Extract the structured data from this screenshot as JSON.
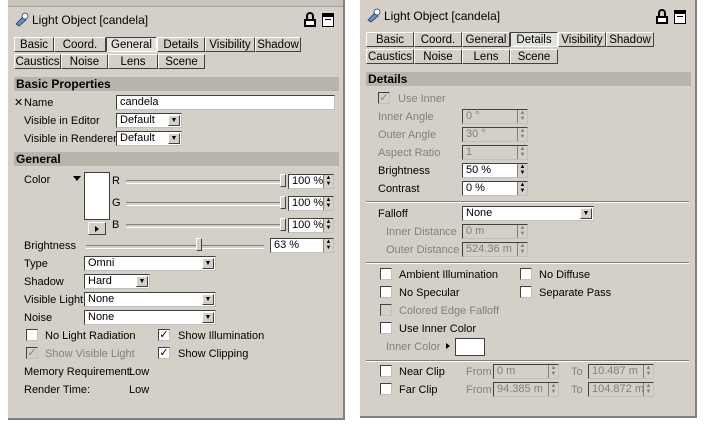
{
  "left": {
    "title": "Light Object [candela]",
    "tabs_row1": [
      "Basic",
      "Coord.",
      "General",
      "Details",
      "Visibility",
      "Shadow"
    ],
    "tabs_row2": [
      "Caustics",
      "Noise",
      "Lens",
      "Scene"
    ],
    "active_tab": "General",
    "basic_section": "Basic Properties",
    "name_label": "Name",
    "name_value": "candela",
    "vis_editor_label": "Visible in Editor",
    "vis_editor_value": "Default",
    "vis_renderer_label": "Visible in Renderer",
    "vis_renderer_value": "Default",
    "general_section": "General",
    "color_label": "Color",
    "r_label": "R",
    "r_value": "100 %",
    "g_label": "G",
    "g_value": "100 %",
    "b_label": "B",
    "b_value": "100 %",
    "rgb_levels_percent": [
      100,
      100,
      100
    ],
    "brightness_label": "Brightness",
    "brightness_value": "63 %",
    "brightness_percent": 63,
    "type_label": "Type",
    "type_value": "Omni",
    "shadow_label": "Shadow",
    "shadow_value": "Hard",
    "visible_light_label": "Visible Light",
    "visible_light_value": "None",
    "noise_label": "Noise",
    "noise_value": "None",
    "no_light_radiation": "No Light Radiation",
    "show_illumination": "Show Illumination",
    "show_visible_light": "Show Visible Light",
    "show_clipping": "Show Clipping",
    "memory_label": "Memory Requirement:",
    "memory_value": "Low",
    "render_time_label": "Render Time:",
    "render_time_value": "Low"
  },
  "right": {
    "title": "Light Object [candela]",
    "tabs_row1": [
      "Basic",
      "Coord.",
      "General",
      "Details",
      "Visibility",
      "Shadow"
    ],
    "tabs_row2": [
      "Caustics",
      "Noise",
      "Lens",
      "Scene"
    ],
    "active_tab": "Details",
    "details_section": "Details",
    "use_inner": "Use Inner",
    "inner_angle_label": "Inner Angle",
    "inner_angle_value": "0 °",
    "outer_angle_label": "Outer Angle",
    "outer_angle_value": "30 °",
    "aspect_ratio_label": "Aspect Ratio",
    "aspect_ratio_value": "1",
    "brightness_label": "Brightness",
    "brightness_value": "50 %",
    "contrast_label": "Contrast",
    "contrast_value": "0 %",
    "falloff_label": "Falloff",
    "falloff_value": "None",
    "inner_distance_label": "Inner Distance",
    "inner_distance_value": "0 m",
    "outer_distance_label": "Outer Distance",
    "outer_distance_value": "524.36 m",
    "ambient_illumination": "Ambient Illumination",
    "no_diffuse": "No Diffuse",
    "no_specular": "No Specular",
    "separate_pass": "Separate Pass",
    "colored_edge_falloff": "Colored Edge Falloff",
    "use_inner_color": "Use Inner Color",
    "inner_color_label": "Inner Color",
    "near_clip": "Near Clip",
    "near_from_label": "From",
    "near_from_value": "0 m",
    "near_to_label": "To",
    "near_to_value": "10.487 m",
    "far_clip": "Far Clip",
    "far_from_label": "From",
    "far_from_value": "94.385 m",
    "far_to_label": "To",
    "far_to_value": "104.872 m"
  },
  "colors": {
    "panel": "#d4d0c8",
    "section": "#b8b4ac",
    "disabled_text": "#808080"
  },
  "icons": [
    "light-object-icon",
    "lock-icon",
    "window-icon",
    "checkmark-icon",
    "dropdown-arrow-icon",
    "spinner-arrows-icon"
  ]
}
